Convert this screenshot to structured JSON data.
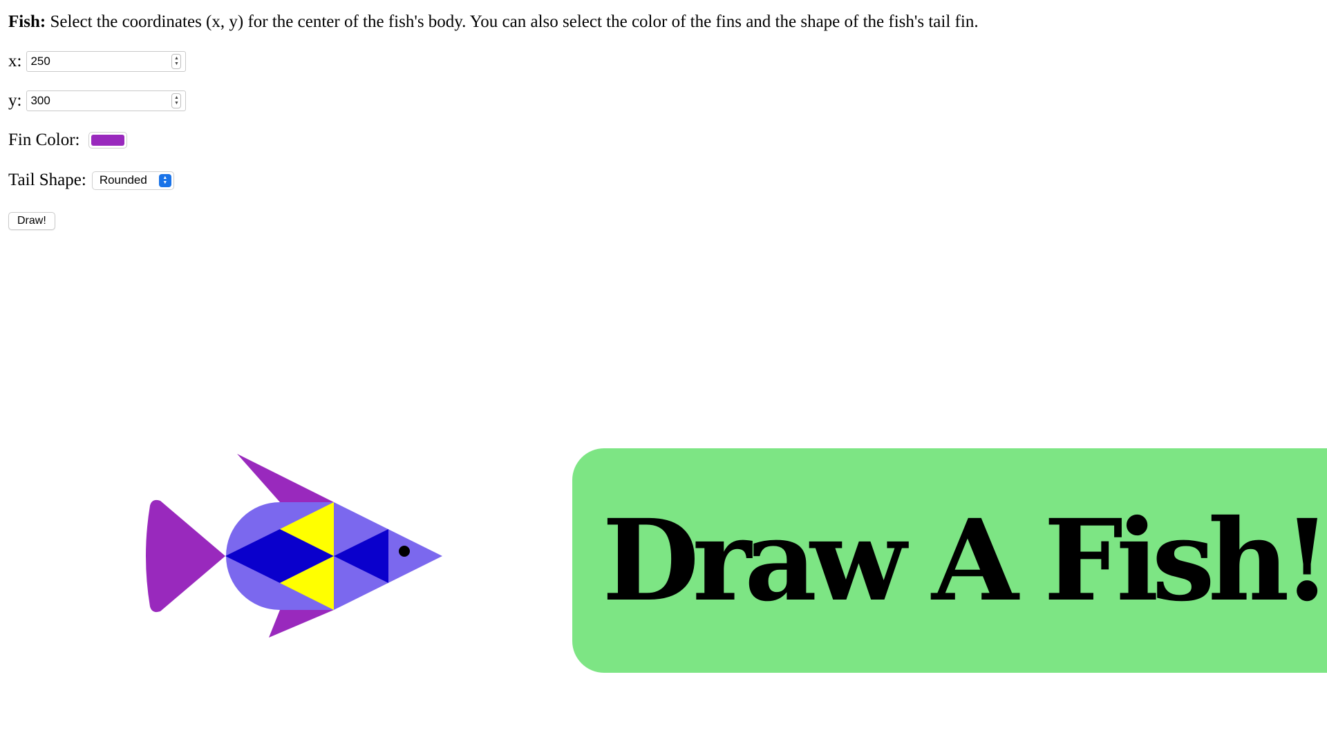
{
  "instructions": {
    "bold": "Fish:",
    "text": " Select the coordinates (x, y) for the center of the fish's body. You can also select the color of the fins and the shape of the fish's tail fin."
  },
  "form": {
    "x": {
      "label": "x:",
      "value": "250"
    },
    "y": {
      "label": "y:",
      "value": "300"
    },
    "fin_color": {
      "label": "Fin Color:",
      "value": "#9929bd"
    },
    "tail_shape": {
      "label": "Tail Shape:",
      "selected": "Rounded"
    },
    "draw_button": "Draw!"
  },
  "banner": {
    "text": "Draw A Fish!",
    "background": "#7de584"
  },
  "fish": {
    "fin_color": "#9929bd",
    "body_color": "#7b68ee",
    "dark_color": "#0a00cc",
    "highlight_color": "#ffff00",
    "eye_color": "#000000"
  },
  "colors": {
    "select_accent": "#1a73e8"
  }
}
